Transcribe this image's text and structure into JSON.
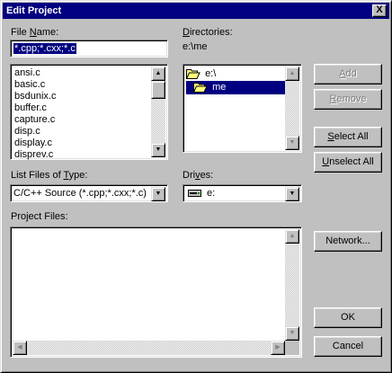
{
  "title": "Edit Project",
  "close_glyph": "X",
  "file_name": {
    "label_pre": "File ",
    "label_key": "N",
    "label_post": "ame:",
    "value": "*.cpp;*.cxx;*.c"
  },
  "files": [
    "ansi.c",
    "basic.c",
    "bsdunix.c",
    "buffer.c",
    "capture.c",
    "disp.c",
    "display.c",
    "disprev.c"
  ],
  "directories": {
    "label_key": "D",
    "label_post": "irectories:",
    "current_path": "e:\\me",
    "items": [
      {
        "name": "e:\\",
        "icon": "open-folder-icon",
        "selected": false
      },
      {
        "name": "me",
        "icon": "open-folder-icon",
        "selected": true
      }
    ]
  },
  "list_type": {
    "label_pre": "List Files of ",
    "label_key": "T",
    "label_post": "ype:",
    "value": "C/C++ Source (*.cpp;*.cxx;*.c)"
  },
  "drives": {
    "label_pre": "Dri",
    "label_key": "v",
    "label_post": "es:",
    "value": "e:",
    "icon": "drive-icon"
  },
  "project_files": {
    "label": "Project Files:"
  },
  "buttons": {
    "add": {
      "key": "A",
      "rest": "dd",
      "enabled": false
    },
    "remove": {
      "key": "R",
      "rest": "emove",
      "enabled": false
    },
    "select_all": {
      "pre": "",
      "key": "S",
      "rest": "elect All"
    },
    "unselect_all": {
      "key": "U",
      "rest": "nselect All"
    },
    "network": {
      "label": "Network..."
    },
    "ok": {
      "label": "OK"
    },
    "cancel": {
      "label": "Cancel"
    }
  },
  "arrows": {
    "up": "▲",
    "down": "▼",
    "left": "◀",
    "right": "▶"
  },
  "colors": {
    "face": "#c0c0c0",
    "titlebar": "#000080",
    "selection": "#000080",
    "disabled_text": "#808080"
  }
}
